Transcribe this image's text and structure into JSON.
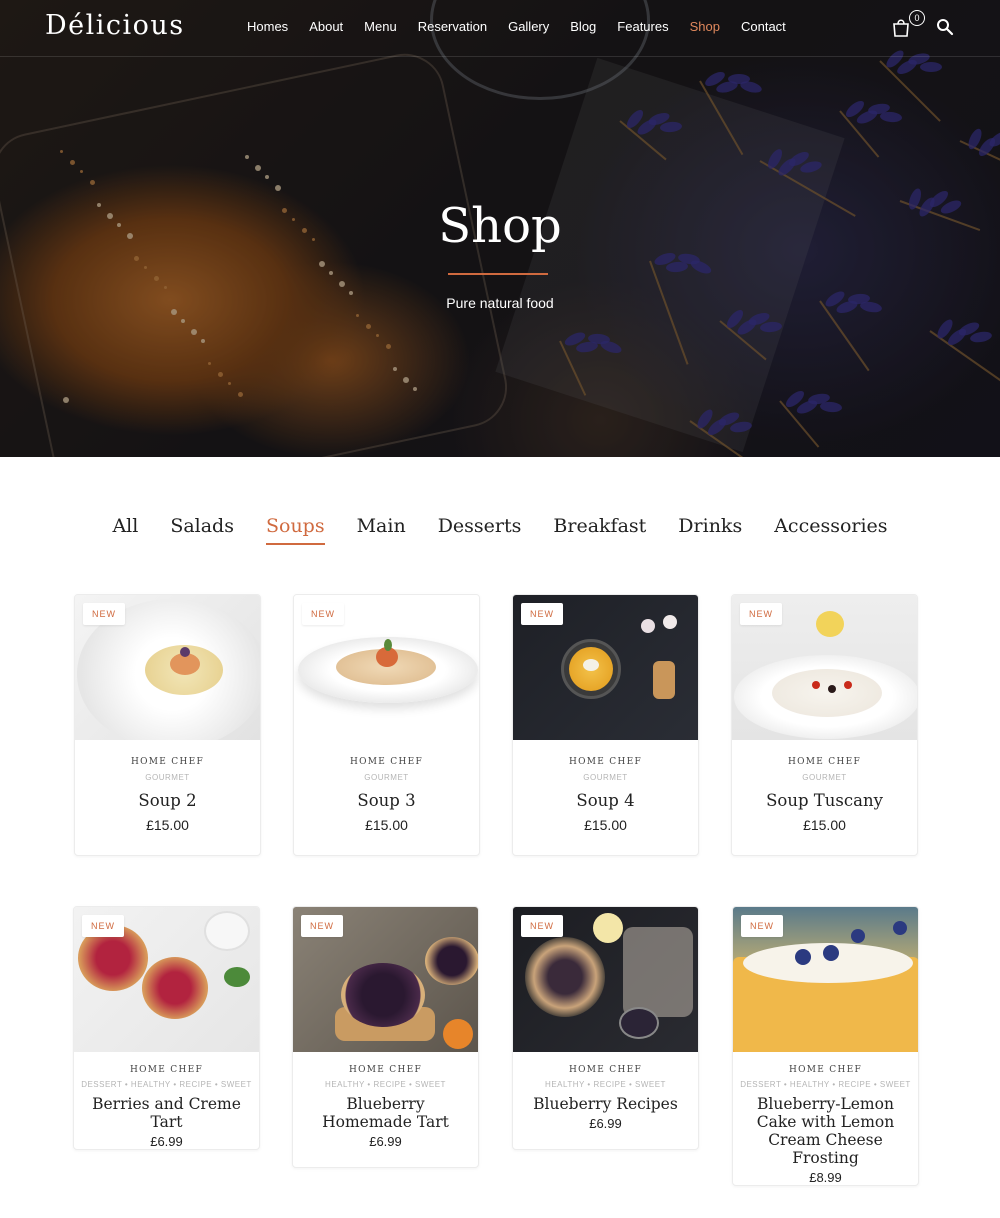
{
  "header": {
    "logo": "Délicious",
    "nav": [
      "Homes",
      "About",
      "Menu",
      "Reservation",
      "Gallery",
      "Blog",
      "Features",
      "Shop",
      "Contact"
    ],
    "active_nav": "Shop",
    "cart_count": "0",
    "icons": [
      "cart-icon",
      "search-icon"
    ]
  },
  "hero": {
    "title": "Shop",
    "subtitle": "Pure natural food"
  },
  "filters": {
    "tabs": [
      "All",
      "Salads",
      "Soups",
      "Main",
      "Desserts",
      "Breakfast",
      "Drinks",
      "Accessories"
    ],
    "active": "Soups"
  },
  "colors": {
    "accent": "#d06a3f",
    "text": "#222222",
    "muted": "#b5b5b5"
  },
  "products": [
    {
      "badge": "NEW",
      "brand": "HOME CHEF",
      "categories": "GOURMET",
      "name": "Soup 2",
      "price": "£15.00"
    },
    {
      "badge": "NEW",
      "brand": "HOME CHEF",
      "categories": "GOURMET",
      "name": "Soup 3",
      "price": "£15.00"
    },
    {
      "badge": "NEW",
      "brand": "HOME CHEF",
      "categories": "GOURMET",
      "name": "Soup 4",
      "price": "£15.00"
    },
    {
      "badge": "NEW",
      "brand": "HOME CHEF",
      "categories": "GOURMET",
      "name": "Soup Tuscany",
      "price": "£15.00"
    },
    {
      "badge": "NEW",
      "brand": "HOME CHEF",
      "categories": "DESSERT • HEALTHY • RECIPE • SWEET",
      "name": "Berries and Creme Tart",
      "price": "£6.99"
    },
    {
      "badge": "NEW",
      "brand": "HOME CHEF",
      "categories": "HEALTHY • RECIPE • SWEET",
      "name": "Blueberry Homemade Tart",
      "price": "£6.99"
    },
    {
      "badge": "NEW",
      "brand": "HOME CHEF",
      "categories": "HEALTHY • RECIPE • SWEET",
      "name": "Blueberry Recipes",
      "price": "£6.99"
    },
    {
      "badge": "NEW",
      "brand": "HOME CHEF",
      "categories": "DESSERT • HEALTHY • RECIPE • SWEET",
      "name": "Blueberry-Lemon Cake with Lemon Cream Cheese Frosting",
      "price": "£8.99"
    }
  ]
}
